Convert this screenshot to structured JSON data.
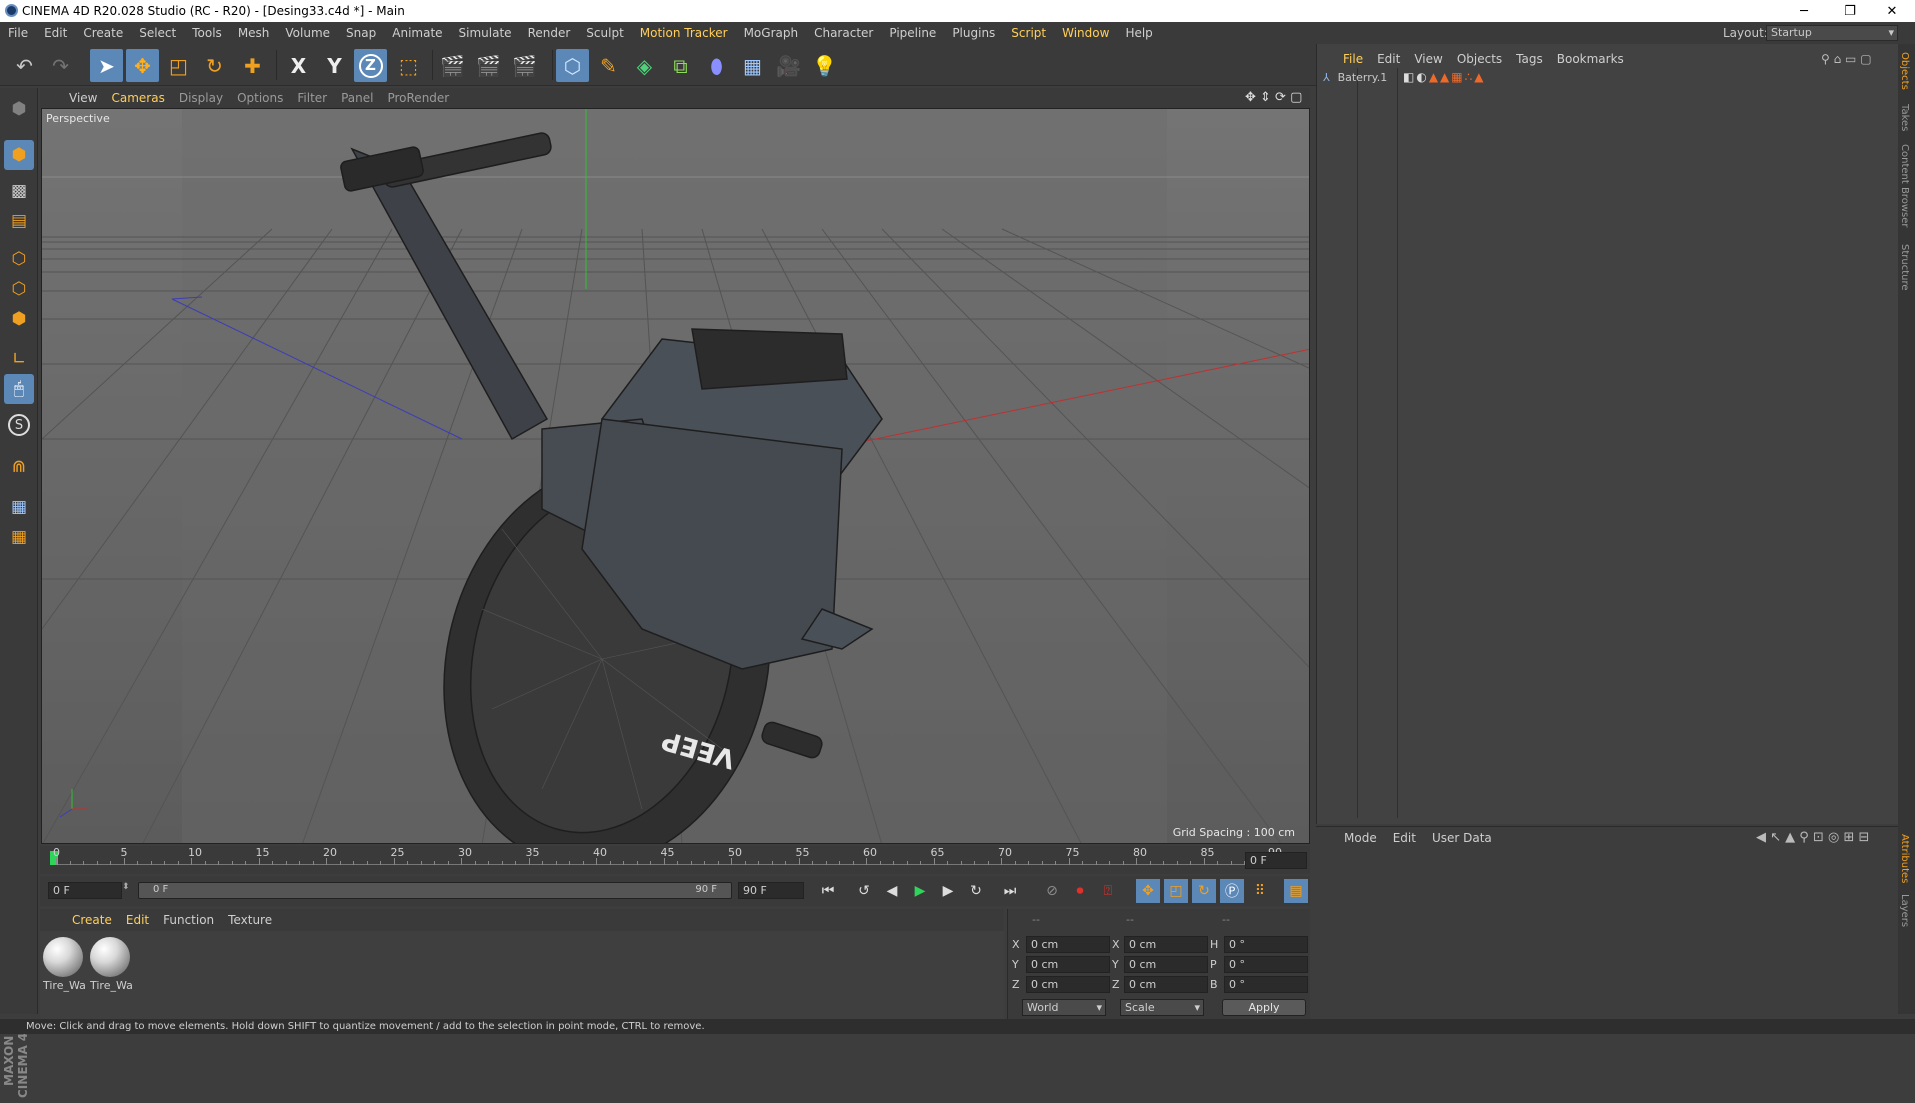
{
  "window": {
    "title": "CINEMA 4D R20.028 Studio (RC - R20) - [Desing33.c4d *] - Main"
  },
  "menu": [
    "File",
    "Edit",
    "Create",
    "Select",
    "Tools",
    "Mesh",
    "Volume",
    "Snap",
    "Animate",
    "Simulate",
    "Render",
    "Sculpt",
    "Motion Tracker",
    "MoGraph",
    "Character",
    "Pipeline",
    "Plugins",
    "Script",
    "Window",
    "Help"
  ],
  "layout": {
    "label": "Layout:",
    "value": "Startup"
  },
  "toolbar": {
    "axis_x": "X",
    "axis_y": "Y",
    "axis_z": "Z"
  },
  "viewport": {
    "menu": [
      "View",
      "Cameras",
      "Display",
      "Options",
      "Filter",
      "Panel",
      "ProRender"
    ],
    "camera": "Perspective",
    "grid_spacing": "Grid Spacing : 100 cm",
    "wheel_text": "VEEP"
  },
  "objects_panel": {
    "menu": [
      "File",
      "Edit",
      "View",
      "Objects",
      "Tags",
      "Bookmarks"
    ],
    "object": "Baterry.1"
  },
  "attributes_panel": {
    "menu": [
      "Mode",
      "Edit",
      "User Data"
    ]
  },
  "side_tabs": [
    "Objects",
    "Takes",
    "Content Browser",
    "Structure",
    "Attributes",
    "Layers"
  ],
  "timeline": {
    "ticks": [
      "0",
      "5",
      "10",
      "15",
      "20",
      "25",
      "30",
      "35",
      "40",
      "45",
      "50",
      "55",
      "60",
      "65",
      "70",
      "75",
      "80",
      "85",
      "90"
    ],
    "frame_field": "0 F",
    "current": "0 F",
    "range_start": "0 F",
    "range_end": "90 F",
    "end": "90 F"
  },
  "materials": {
    "menu": [
      "Create",
      "Edit",
      "Function",
      "Texture"
    ],
    "items": [
      "Tire_Wa",
      "Tire_Wa"
    ]
  },
  "coordinates": {
    "header": [
      "--",
      "--",
      "--"
    ],
    "rows": [
      {
        "a": "X",
        "av": "0 cm",
        "b": "X",
        "bv": "0 cm",
        "c": "H",
        "cv": "0 °"
      },
      {
        "a": "Y",
        "av": "0 cm",
        "b": "Y",
        "bv": "0 cm",
        "c": "P",
        "cv": "0 °"
      },
      {
        "a": "Z",
        "av": "0 cm",
        "b": "Z",
        "bv": "0 cm",
        "c": "B",
        "cv": "0 °"
      }
    ],
    "space": "World",
    "mode": "Scale",
    "apply": "Apply"
  },
  "brand": "MAXON CINEMA 4D",
  "status": "Move: Click and drag to move elements. Hold down SHIFT to quantize movement / add to the selection in point mode, CTRL to remove."
}
